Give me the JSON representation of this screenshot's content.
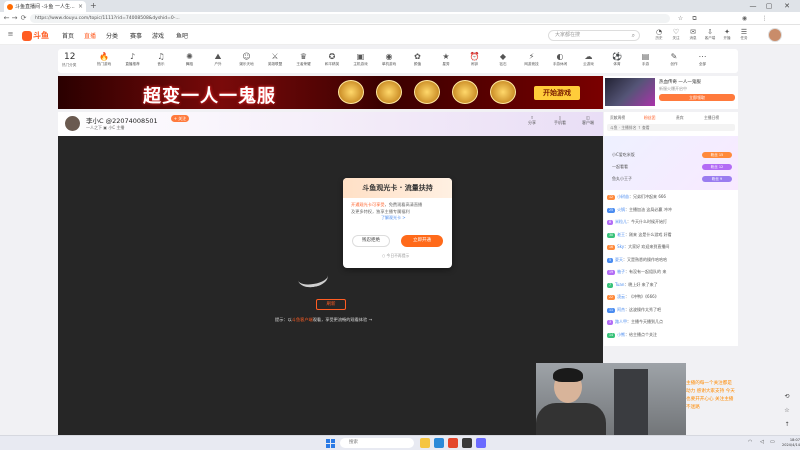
{
  "browser": {
    "tab_title": "斗鱼直播间 -斗鱼 一人生...",
    "tab_close": "×",
    "new_tab": "+",
    "url": "https://www.douyu.com/topic/1111?rid=74008508&dyshid=0-...",
    "window_controls": [
      "—",
      "▢",
      "✕"
    ]
  },
  "header": {
    "logo": "斗鱼",
    "nav": [
      "首页",
      "直播",
      "分类",
      "赛事",
      "游戏",
      "鱼吧"
    ],
    "nav_active_index": 1,
    "search_placeholder": "大家都在搜",
    "icons": [
      {
        "glyph": "◔",
        "label": "历史"
      },
      {
        "glyph": "♡",
        "label": "关注"
      },
      {
        "glyph": "✉",
        "label": "消息"
      },
      {
        "glyph": "⇩",
        "label": "客户端"
      },
      {
        "glyph": "✦",
        "label": "开播"
      },
      {
        "glyph": "☰",
        "label": "任务"
      }
    ]
  },
  "categories": {
    "count": "12",
    "count_label": "热门分类",
    "items": [
      "热门游戏",
      "直播推荐",
      "音乐",
      "舞蹈",
      "户外",
      "娱乐天地",
      "英雄联盟",
      "王者荣耀",
      "和平精英",
      "主机游戏",
      "单机游戏",
      "颜值",
      "星秀",
      "闹钟",
      "钻石",
      "网游竞技",
      "手游休闲",
      "云游戏",
      "体育",
      "手游",
      "创作",
      "全部"
    ]
  },
  "banner": {
    "headline": "超变一人一鬼服",
    "button": "开始游戏"
  },
  "ad": {
    "title": "热血传奇 一人一鬼服",
    "sub": "新服火爆开启中",
    "button": "立即领取"
  },
  "room": {
    "title": "李小C @22074008501",
    "sub": "一人之下  ▣ 小C 主播",
    "follow": "+ 关注",
    "actions": [
      "分享",
      "手机看",
      "客户端"
    ]
  },
  "player": {
    "replay": "刷新",
    "msg_pre": "提示：以",
    "msg_hl": "斗鱼客户端",
    "msg_post": "观看，享受更流畅的观看体验 →"
  },
  "modal": {
    "title": "斗鱼观光卡 · 流量扶持",
    "line1_hl": "开通观光卡可享受",
    "line1": "，免费观看高清直播",
    "line2": "及更多特权，独享主播专属福利",
    "link": "了解观光卡 >",
    "cancel": "残忍拒绝",
    "buy": "立即开通",
    "checkbox": "○ 今日不再提示"
  },
  "right": {
    "rank_tabs": [
      "贡献周榜",
      "粉丝团",
      "贵宾",
      "主播日榜"
    ],
    "rank_row": "斗鱼 · 主播排名    ↑ 查看",
    "fans": [
      {
        "name": "小C爱吃米饭",
        "badge": "粉丝 15"
      },
      {
        "name": "一起看看",
        "badge": "粉丝 12"
      },
      {
        "name": "鱼丸小王子",
        "badge": "粉丝 9"
      }
    ],
    "chat": [
      {
        "lv": "12",
        "nm": "小树苗",
        "tx": "：兄弟们冲起来 666"
      },
      {
        "lv": "25",
        "nm": "火锅",
        "tx": "：主播加油 这局必赢 冲冲"
      },
      {
        "lv": "8",
        "nm": "米粒儿",
        "tx": "：今天什么时候开始打"
      },
      {
        "lv": "30",
        "nm": "老王",
        "tx": "：刚来 这是什么游戏 好看"
      },
      {
        "lv": "16",
        "nm": "Sky",
        "tx": "：大家好 欢迎来到直播间"
      },
      {
        "lv": "5",
        "nm": "夏天",
        "tx": "：又是熟悉的操作哈哈哈"
      },
      {
        "lv": "19",
        "nm": "柚子",
        "tx": "：有没有一起组队的 来"
      },
      {
        "lv": "7",
        "nm": "Tuan",
        "tx": "：晚上好 来了来了"
      },
      {
        "lv": "22",
        "nm": "凌云",
        "tx": "：《冲鸭》《666》"
      },
      {
        "lv": "11",
        "nm": "阿杰",
        "tx": "：这波操作太秀了吧"
      },
      {
        "lv": "3",
        "nm": "路人甲",
        "tx": "：主播今天播到几点"
      },
      {
        "lv": "14",
        "nm": "小熊",
        "tx": "：给主播点个关注"
      }
    ]
  },
  "overlay_text": "主播的每一个关注都是动力 感谢大家支持 今天也要开开心心 关注主播不迷路",
  "right_tools": [
    "⟲",
    "☆",
    "↑",
    "⋯"
  ],
  "taskbar": {
    "search": "搜索",
    "time": "18:07",
    "date": "2024/4/14"
  },
  "colors": {
    "brand": "#ff5d23",
    "video_bg": "#262626"
  }
}
